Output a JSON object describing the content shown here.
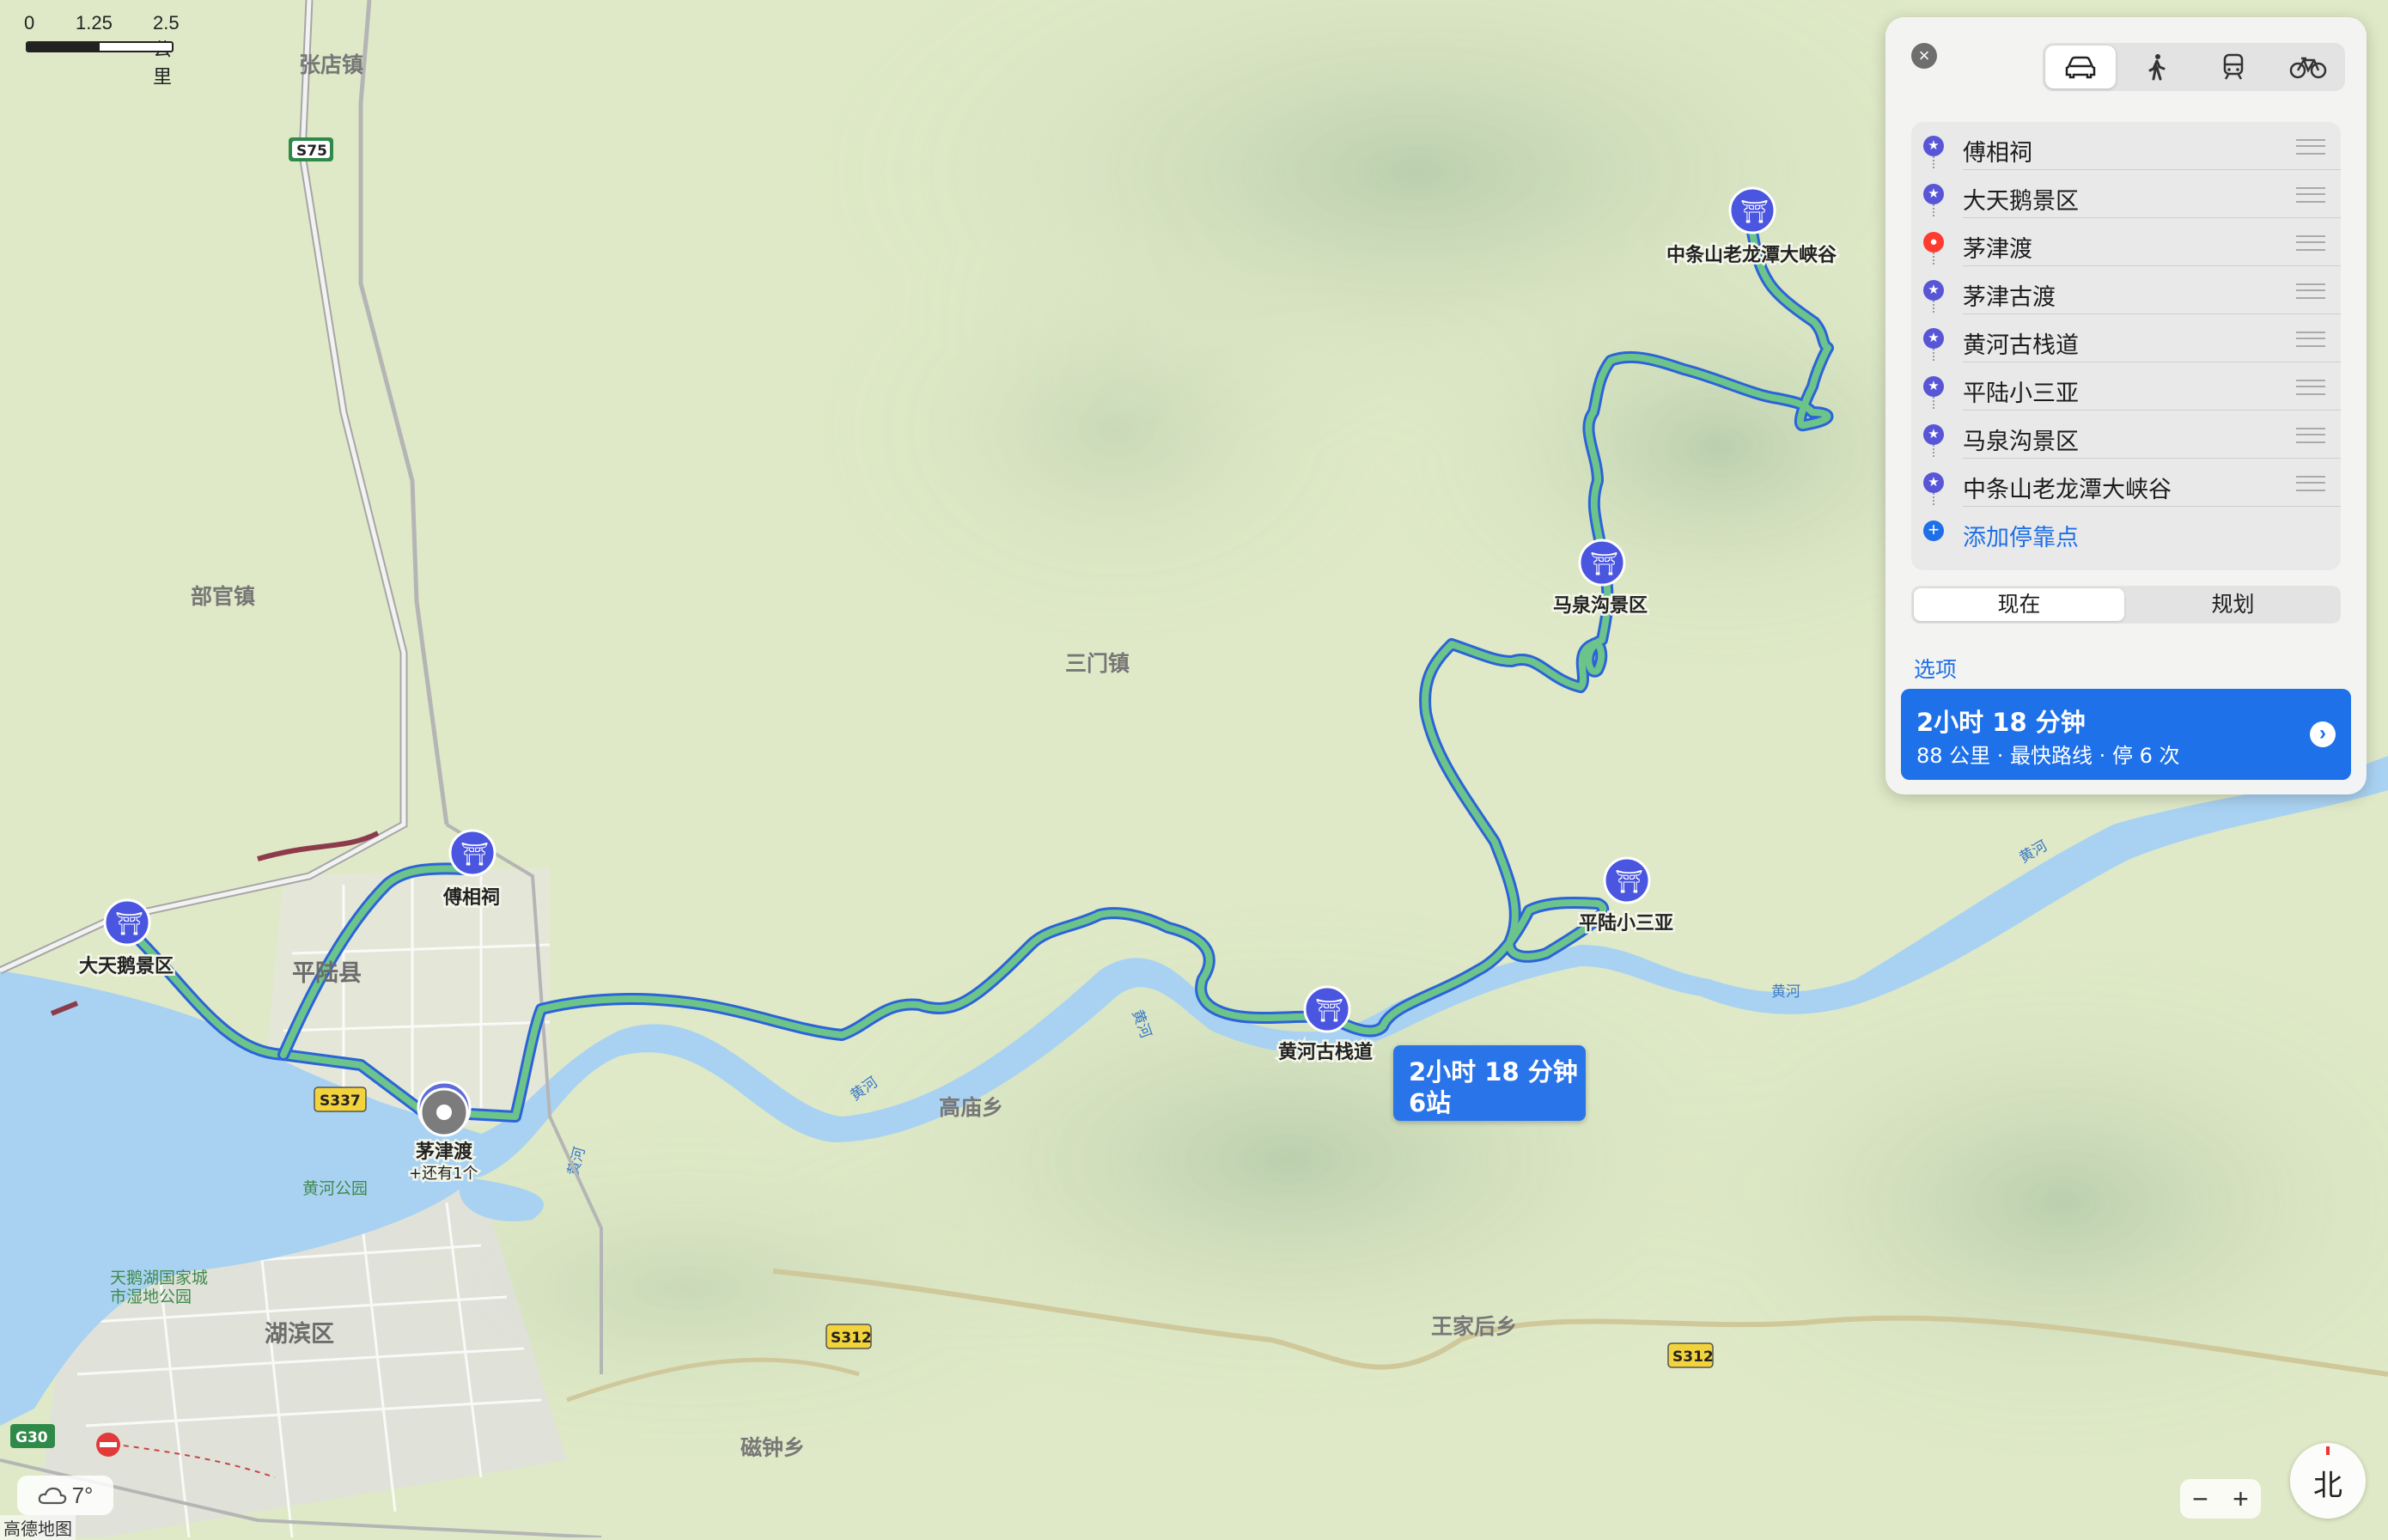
{
  "scale": {
    "labels": [
      "0",
      "1.25",
      "2.5 公里"
    ]
  },
  "panel": {
    "close_icon": "×",
    "modes": [
      {
        "name": "car",
        "icon": "car-icon",
        "active": true
      },
      {
        "name": "walk",
        "icon": "walk-icon",
        "active": false
      },
      {
        "name": "transit",
        "icon": "transit-icon",
        "active": false
      },
      {
        "name": "bike",
        "icon": "bike-icon",
        "active": false
      }
    ],
    "stops": [
      {
        "label": "傅相祠",
        "icon": "★"
      },
      {
        "label": "大天鹅景区",
        "icon": "★"
      },
      {
        "label": "茅津渡",
        "icon": "●"
      },
      {
        "label": "茅津古渡",
        "icon": "★"
      },
      {
        "label": "黄河古栈道",
        "icon": "★"
      },
      {
        "label": "平陆小三亚",
        "icon": "★"
      },
      {
        "label": "马泉沟景区",
        "icon": "★"
      },
      {
        "label": "中条山老龙潭大峡谷",
        "icon": "★"
      }
    ],
    "add_stop": {
      "label": "添加停靠点",
      "icon": "+"
    },
    "time_segment": {
      "now": "现在",
      "plan": "规划"
    },
    "options_label": "选项",
    "route": {
      "time": "2小时 18 分钟",
      "summary": "88 公里 · 最快路线 · 停 6 次",
      "chevron": "›"
    }
  },
  "callout": {
    "time": "2小时 18 分钟",
    "stops": "6站"
  },
  "map": {
    "places": [
      "平陆县",
      "湖滨区",
      "部官镇",
      "三门镇",
      "高庙乡",
      "王家后乡",
      "磁钟乡",
      "张店镇"
    ],
    "pois": [
      "傅相祠",
      "大天鹅景区",
      "黄河古栈道",
      "平陆小三亚",
      "马泉沟景区",
      "中条山老龙潭大峡谷"
    ],
    "maojin": {
      "label": "茅津渡",
      "more": "+还有1个"
    },
    "green_labels": [
      "黄河公园",
      "天鹅湖国家城",
      "市湿地公园"
    ],
    "river_label": "黄河",
    "shields": [
      "S75",
      "S337",
      "S312",
      "S312",
      "G30"
    ],
    "colors": {
      "route": "#6cc48b",
      "route_casing": "#2b63d9",
      "water": "#a9d2f2",
      "poi": "#4a55e0"
    }
  },
  "weather": {
    "icon": "cloud-icon",
    "temp": "7°"
  },
  "attribution": "高德地图",
  "zoom": {
    "out": "−",
    "in": "+"
  },
  "compass": {
    "label": "北"
  }
}
